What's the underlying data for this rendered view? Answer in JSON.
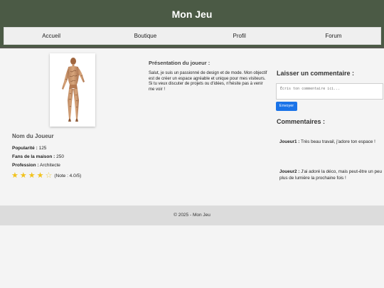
{
  "site": {
    "title": "Mon Jeu"
  },
  "nav": {
    "items": [
      "Accueil",
      "Boutique",
      "Profil",
      "Forum"
    ]
  },
  "player": {
    "name": "Nom du Joueur",
    "stats": [
      {
        "label": "Popularité :",
        "value": "125"
      },
      {
        "label": "Fans de la maison :",
        "value": "250"
      },
      {
        "label": "Profession :",
        "value": "Architecte"
      }
    ],
    "rating": {
      "stars_filled": 4,
      "stars_total": 5,
      "note": "(Note : 4.0/5)"
    }
  },
  "presentation": {
    "title": "Présentation du joueur :",
    "text": "Salut, je suis un passionné de design et de mode. Mon objectif est de créer un espace agréable et unique pour mes visiteurs. Si tu veux discuter de projets ou d'idées, n'hésite pas à venir me voir !"
  },
  "comment_form": {
    "title": "Laisser un commentaire :",
    "placeholder": "Écris ton commentaire ici...",
    "button_label": "Envoyer"
  },
  "comments": {
    "title": "Commentaires :",
    "items": [
      {
        "author": "Joueur1 :",
        "text": " Très beau travail, j'adore ton espace !"
      },
      {
        "author": "Joueur2 :",
        "text": " J'ai adoré la déco, mais peut-être un peu plus de lumière la prochaine fois !"
      }
    ]
  },
  "footer": {
    "text": "© 2025 - Mon Jeu"
  },
  "colors": {
    "header": "#4b5a45",
    "accent": "#1a73e8",
    "star": "#f2c21b"
  },
  "icons": {
    "star": "star-icon"
  }
}
